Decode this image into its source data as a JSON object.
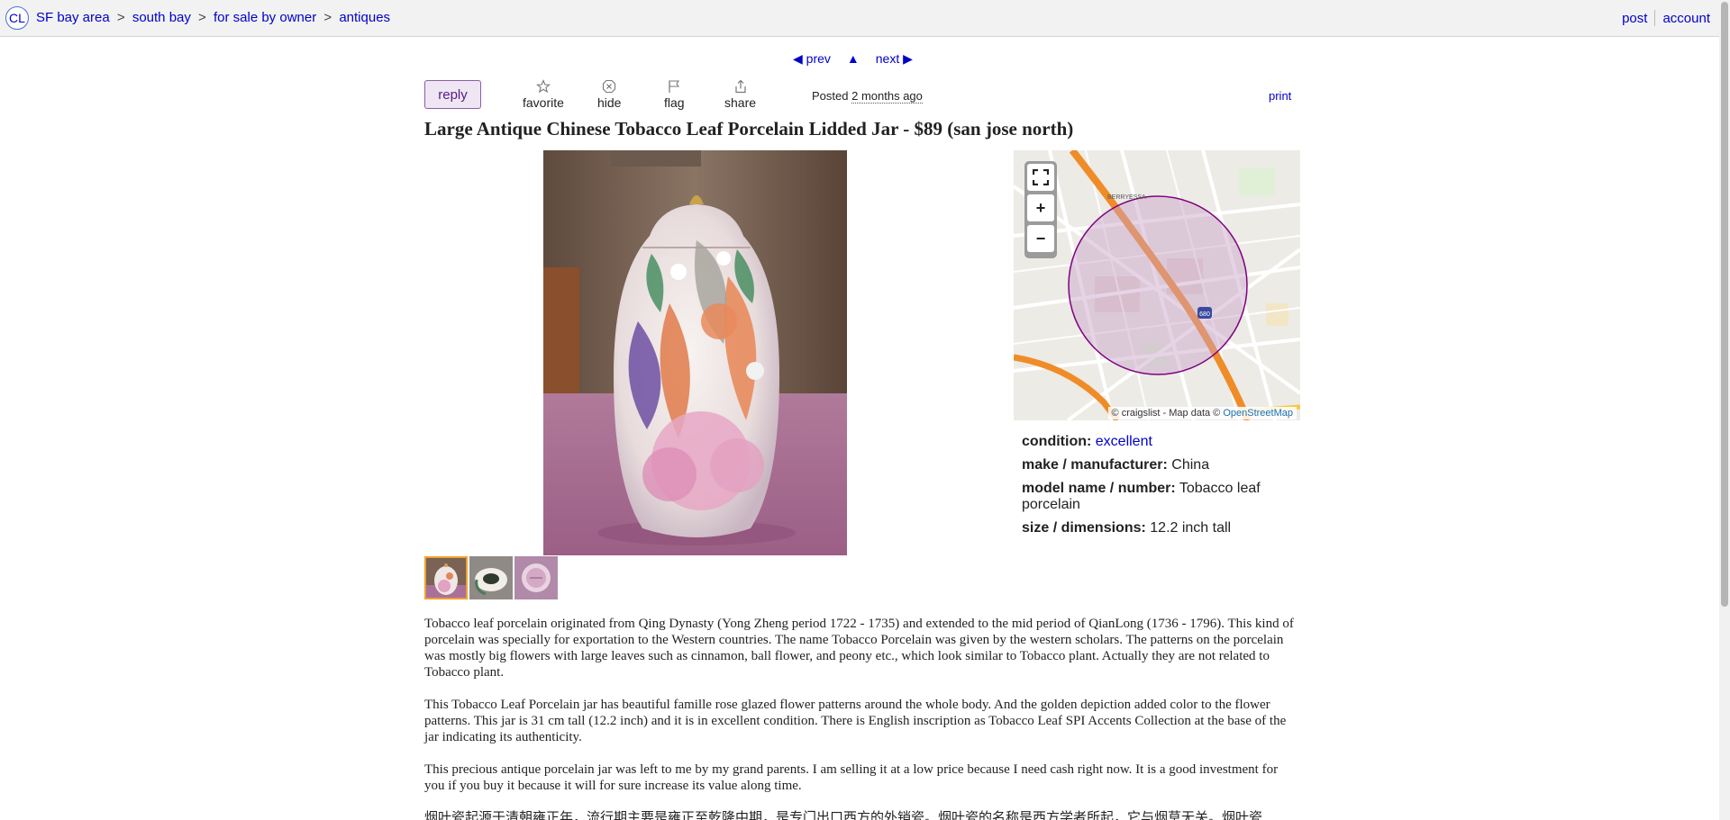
{
  "header": {
    "logo": "CL",
    "breadcrumbs": [
      "SF bay area",
      "south bay",
      "for sale by owner",
      "antiques"
    ],
    "breadcrumb_sep": ">",
    "post_label": "post",
    "account_label": "account"
  },
  "pager": {
    "prev_label": "◀ prev",
    "up_label": "▲",
    "next_label": "next ▶"
  },
  "actions": {
    "reply_label": "reply",
    "favorite_label": "favorite",
    "hide_label": "hide",
    "flag_label": "flag",
    "share_label": "share",
    "posted_prefix": "Posted",
    "posted_ago": "2 months ago",
    "print_label": "print"
  },
  "listing": {
    "title": "Large Antique Chinese Tobacco Leaf Porcelain Lidded Jar - $89 (san jose north)"
  },
  "map": {
    "attribution_prefix": "© craigslist - Map data ©",
    "attribution_link": "OpenStreetMap",
    "fullscreen_icon": "fullscreen-icon",
    "zoom_in": "+",
    "zoom_out": "−",
    "labels": {
      "berryessa": "BERRYESSA",
      "highway": "680"
    }
  },
  "attributes": [
    {
      "label": "condition:",
      "value": "excellent",
      "link": true
    },
    {
      "label": "make / manufacturer:",
      "value": "China",
      "link": false
    },
    {
      "label": "model name / number:",
      "value": "Tobacco leaf porcelain",
      "link": false
    },
    {
      "label": "size / dimensions:",
      "value": "12.2 inch tall",
      "link": false
    }
  ],
  "body": [
    "Tobacco leaf porcelain originated from Qing Dynasty (Yong Zheng period 1722 - 1735) and extended to the mid period of QianLong (1736 - 1796). This kind of porcelain was specially for exportation to the Western countries. The name Tobacco Porcelain was given by the western scholars. The patterns on the porcelain was mostly big flowers with large leaves such as cinnamon, ball flower, and peony etc., which look similar to Tobacco plant. Actually they are not related to Tobacco plant.",
    "This Tobacco Leaf Porcelain jar has beautiful famille rose glazed flower patterns around the whole body. And the golden depiction added color to the flower patterns. This jar is 31 cm tall (12.2 inch) and it is in excellent condition. There is English inscription as Tobacco Leaf SPI Accents Collection at the base of the jar indicating its authenticity.",
    "This precious antique porcelain jar was left to me by my grand parents. I am selling it at a low price because I need cash right now. It is a good investment for you if you buy it because it will for sure increase its value along time.",
    "烟叶瓷起源于清朝雍正年，流行期主要是雍正至乾隆中期，是专门出口西方的外销瓷。烟叶瓷的名称是西方学者所起，它与烟草无关。烟叶瓷"
  ],
  "colors": {
    "link": "#0000cc",
    "reply_bg": "#eee6f2",
    "reply_border": "#8e5ea2",
    "map_circle": "#800080",
    "highway": "#f08c28"
  }
}
